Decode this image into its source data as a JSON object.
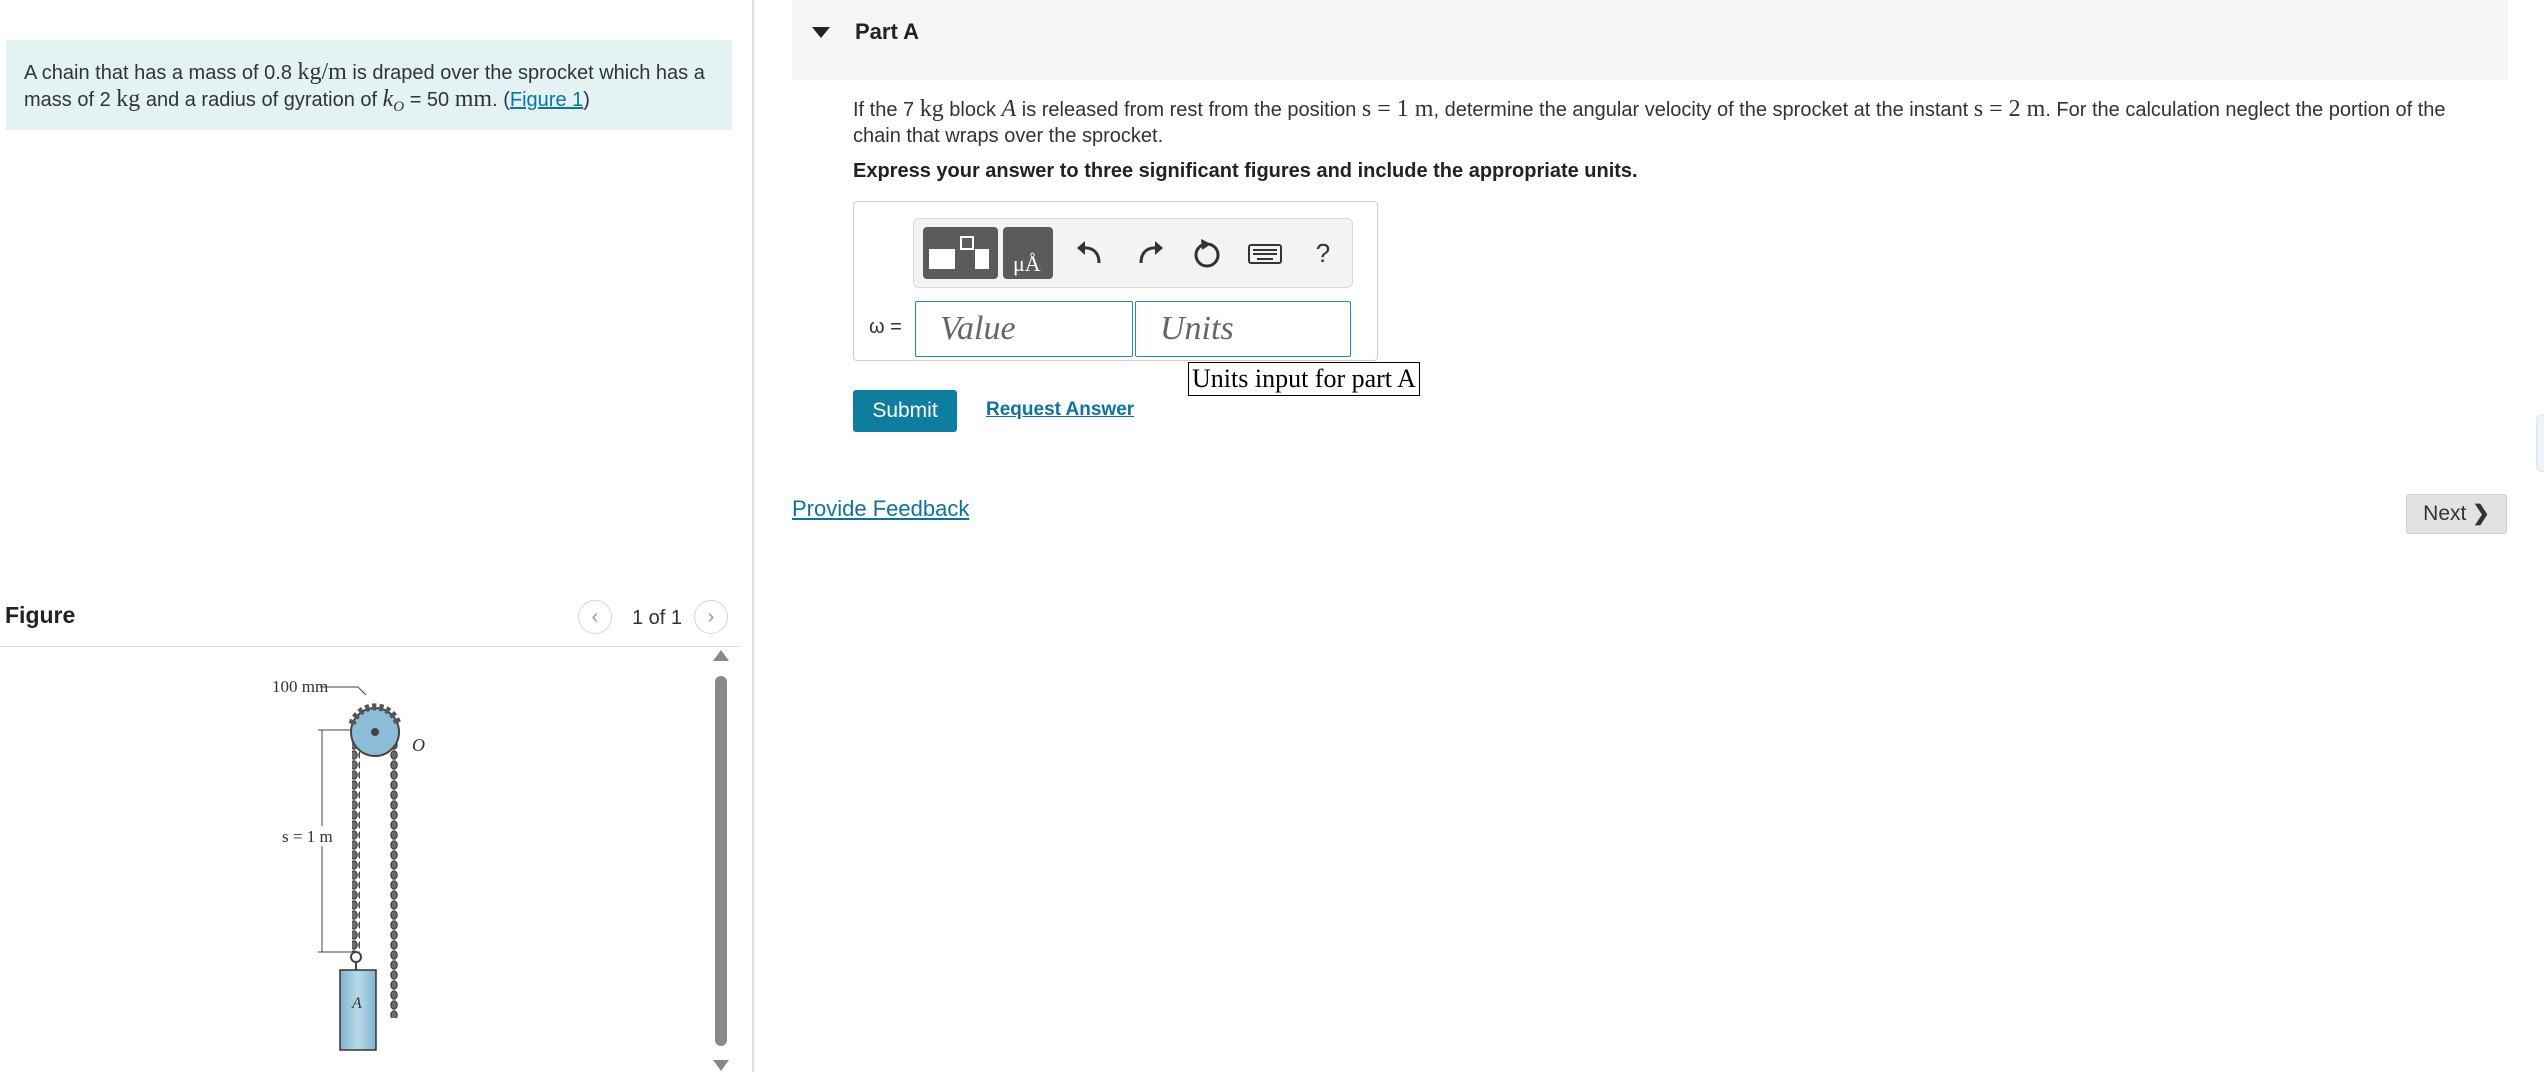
{
  "problem": {
    "t1": "A chain that has a mass of 0.8 ",
    "m1": "kg/m",
    "t2": " is draped over the sprocket which has a mass of 2 ",
    "m2": "kg",
    "t3": " and a radius of gyration of ",
    "m3": "k",
    "m3sub": "O",
    "t4": " = 50 ",
    "m4": "mm",
    "t5": ". (",
    "link": "Figure 1",
    "t6": ")"
  },
  "figure": {
    "title": "Figure",
    "pager": "1 of 1",
    "labels": {
      "dim": "100 mm",
      "o": "O",
      "s": "s = 1 m",
      "a": "A"
    }
  },
  "part": {
    "title": "Part A"
  },
  "question": {
    "t1": "If the 7 ",
    "m1": "kg",
    "t2": " block ",
    "m2": "A",
    "t3": " is released from rest from the position ",
    "m3": "s = 1 m",
    "t4": ", determine the angular velocity of the sprocket at the instant ",
    "m4": "s = 2 m",
    "t5": ". For the calculation neglect the portion of the chain that wraps over the sprocket."
  },
  "instruction": "Express your answer to three significant figures and include the appropriate units.",
  "toolbar": {
    "icons": [
      "templates-icon",
      "units-templates-icon",
      "undo-icon",
      "redo-icon",
      "reset-icon",
      "keyboard-icon",
      "help-icon"
    ],
    "help": "?",
    "units_glyph": "μÅ"
  },
  "answer": {
    "variable": "ω =",
    "value_placeholder": "Value",
    "units_placeholder": "Units",
    "units_tooltip": "Units input for part A"
  },
  "actions": {
    "submit": "Submit",
    "request": "Request Answer",
    "feedback": "Provide Feedback",
    "next": "Next"
  },
  "colors": {
    "accent": "#0e7ea0",
    "link": "#0b73a6",
    "problem_bg": "#e3f3f4"
  }
}
